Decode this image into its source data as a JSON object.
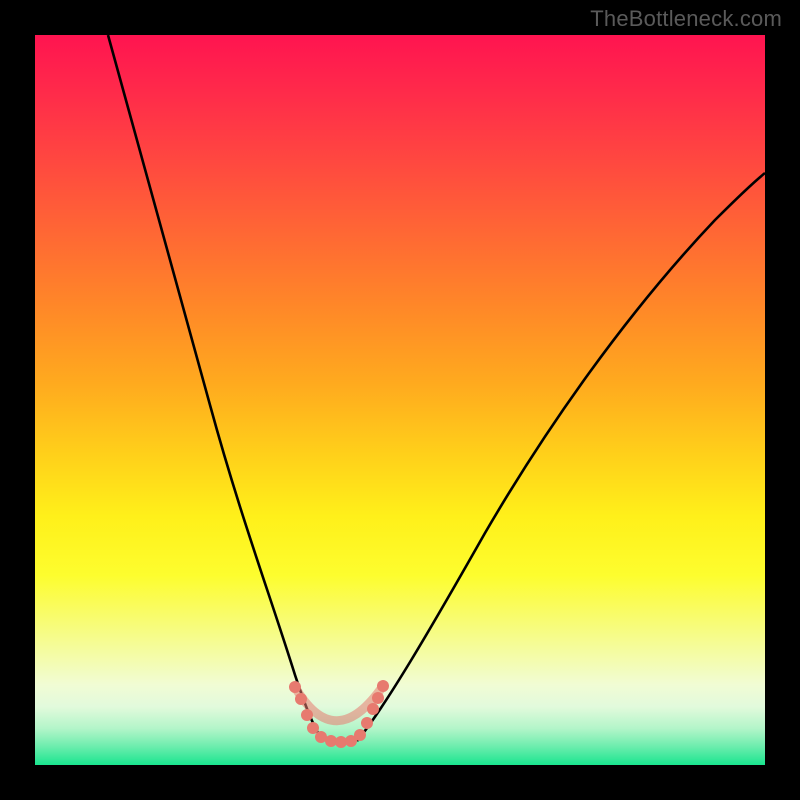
{
  "watermark": "TheBottleneck.com",
  "chart_data": {
    "type": "line",
    "title": "",
    "xlabel": "",
    "ylabel": "",
    "xlim": [
      0,
      100
    ],
    "ylim": [
      0,
      100
    ],
    "grid": false,
    "legend": false,
    "notes": "No ticks or axis labels visible; values represent relative coordinates (0-100) reading left/bottom as origin. Background is a vertical red→orange→yellow→green gradient. Overlay curve is a black V-shaped line with a short salmon dotted stroke near the minimum.",
    "series": [
      {
        "name": "black-curve-left",
        "color": "#000000",
        "x": [
          10,
          12,
          15,
          18,
          21,
          24,
          27,
          30,
          33,
          35,
          37,
          38.5
        ],
        "y": [
          100,
          91,
          78,
          65,
          53,
          42,
          32,
          23,
          15,
          10,
          6,
          4
        ]
      },
      {
        "name": "black-curve-right",
        "color": "#000000",
        "x": [
          45,
          48,
          52,
          57,
          63,
          70,
          78,
          87,
          96,
          100
        ],
        "y": [
          4,
          7,
          12,
          19,
          28,
          38,
          49,
          60,
          71,
          76
        ]
      },
      {
        "name": "salmon-trough-dots",
        "color": "#e77a6f",
        "style": "dotted-thick",
        "x": [
          36,
          37.5,
          39,
          40.5,
          42,
          43.5,
          45,
          46.5,
          47.5
        ],
        "y": [
          10,
          7,
          4.5,
          3.5,
          3.3,
          3.5,
          4.5,
          7,
          10
        ]
      }
    ]
  }
}
